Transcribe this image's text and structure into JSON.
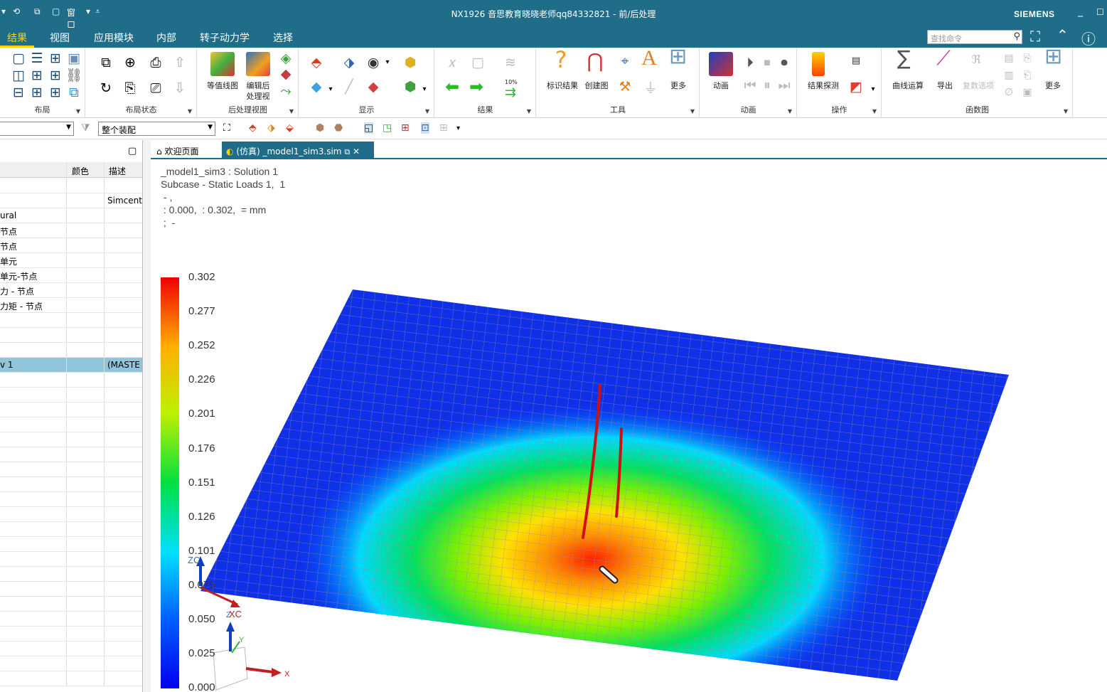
{
  "titlebar": {
    "title": "NX1926 音思教育晓晓老师qq84332821 - 前/后处理",
    "brand": "SIEMENS",
    "quick_access_window": "窗口"
  },
  "menubar": {
    "items": [
      "结果",
      "视图",
      "应用模块",
      "内部",
      "转子动力学",
      "选择"
    ],
    "active": "结果",
    "search_placeholder": "查找命令"
  },
  "ribbon": {
    "groups": [
      {
        "label": "布局"
      },
      {
        "label": "布局状态"
      },
      {
        "label": "后处理视图",
        "buttons": [
          "等值线图",
          "编辑后",
          "处理视"
        ]
      },
      {
        "label": "显示"
      },
      {
        "label": "结果"
      },
      {
        "label": "工具",
        "buttons": [
          "标识结果",
          "创建图",
          "更多"
        ]
      },
      {
        "label": "动画",
        "buttons": [
          "动画"
        ]
      },
      {
        "label": "操作",
        "buttons": [
          "结果探测"
        ]
      },
      {
        "label": "函数图",
        "buttons": [
          "曲线运算",
          "导出",
          "复数选项",
          "更多"
        ]
      }
    ],
    "percent_badge": "10%"
  },
  "toolbar2": {
    "filter_value": "整个装配"
  },
  "nav": {
    "headers": [
      "颜色",
      "描述"
    ],
    "rows": [
      {
        "name": "",
        "desc": ""
      },
      {
        "name": "",
        "desc": "Simcent"
      },
      {
        "name": "ural",
        "desc": ""
      },
      {
        "name": "节点",
        "desc": ""
      },
      {
        "name": "节点",
        "desc": ""
      },
      {
        "name": "单元",
        "desc": ""
      },
      {
        "name": "单元-节点",
        "desc": ""
      },
      {
        "name": "力 - 节点",
        "desc": ""
      },
      {
        "name": "力矩 - 节点",
        "desc": ""
      },
      {
        "name": "",
        "desc": ""
      },
      {
        "name": "",
        "desc": ""
      },
      {
        "name": "",
        "desc": ""
      },
      {
        "name": "v 1",
        "desc": "(MASTE"
      }
    ]
  },
  "tabs": [
    {
      "label": "欢迎页面"
    },
    {
      "label": "(仿真) _model1_sim3.sim"
    }
  ],
  "viewport": {
    "info_lines": [
      "_model1_sim3 : Solution 1",
      "Subcase - Static Loads 1,  1",
      " - ,",
      " : 0.000,  : 0.302,  = mm",
      " ;  -"
    ],
    "legend_values": [
      "0.302",
      "0.277",
      "0.252",
      "0.226",
      "0.201",
      "0.176",
      "0.151",
      "0.126",
      "0.101",
      "0.075",
      "0.050",
      "0.025",
      "0.000"
    ],
    "triad_labels": [
      "ZC",
      "XC",
      "Z",
      "Y",
      "X"
    ]
  }
}
